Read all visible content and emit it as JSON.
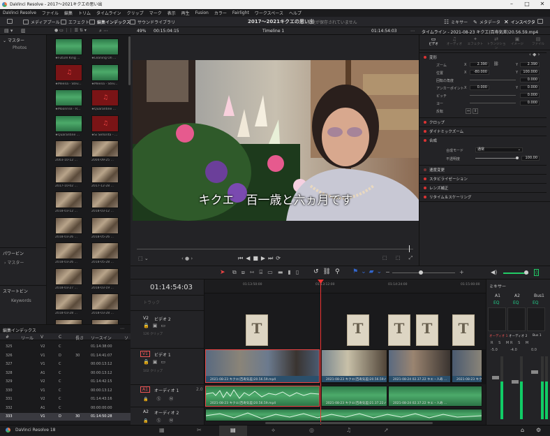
{
  "window": {
    "title": "DaVinci Resolve - 2017～2021キクエの思い出"
  },
  "menu": [
    "DaVinci Resolve",
    "ファイル",
    "編集",
    "トリム",
    "タイムライン",
    "クリップ",
    "マーク",
    "表示",
    "再生",
    "Fusion",
    "カラー",
    "Fairlight",
    "ワークスペース",
    "ヘルプ"
  ],
  "toolbar": {
    "media_pool": "メディアプール",
    "effects": "エフェクト",
    "edit_index": "編集インデックス",
    "sound_library": "サウンドライブラリ",
    "project_title": "2017～2021キクエの思い出",
    "save_status": "変更が保存されていません",
    "mixer": "ミキサー",
    "metadata": "メタデータ",
    "inspector": "インスペクタ"
  },
  "viewer_bar": {
    "zoom": "49%",
    "source_tc": "00:15:04:15",
    "timeline_name": "Timeline 1",
    "record_tc": "01:14:54:03",
    "clip_name": "タイムライン - 2021-08-23 キクエ(百寿気差)20.56.59.mp4"
  },
  "bins": {
    "master": "マスター",
    "photos": "Photos",
    "smart_header": "パワービン",
    "smart_master": "マスター",
    "smartbins": "スマートビン",
    "keywords": "Keywords"
  },
  "media_items": [
    {
      "label": "★Future King ...",
      "kind": "audio"
    },
    {
      "label": "★Leaning On ...",
      "kind": "audio"
    },
    {
      "label": "★Meena - Stev...",
      "kind": "red"
    },
    {
      "label": "★Meena - Stev...",
      "kind": "audio"
    },
    {
      "label": "★Moonrise - R...",
      "kind": "audio"
    },
    {
      "label": "★Quarantine ...",
      "kind": "red"
    },
    {
      "label": "★Quarantine ...",
      "kind": "audio"
    },
    {
      "label": "★Si Señorita - ...",
      "kind": "red"
    },
    {
      "label": "2003-10-12 ...",
      "kind": "photo"
    },
    {
      "label": "2004-09-25 ...",
      "kind": "photo"
    },
    {
      "label": "2017-10-02 ...",
      "kind": "photo"
    },
    {
      "label": "2017-12-28 ...",
      "kind": "photo"
    },
    {
      "label": "2018-03-12 ...",
      "kind": "photo"
    },
    {
      "label": "2018-03-12 ...",
      "kind": "photo"
    },
    {
      "label": "2018-03-26 ...",
      "kind": "photo"
    },
    {
      "label": "2018-05-26 ...",
      "kind": "photo"
    },
    {
      "label": "2018-03-26 ...",
      "kind": "photo"
    },
    {
      "label": "2018-05-28 ...",
      "kind": "photo"
    },
    {
      "label": "2018-03-27 ...",
      "kind": "photo"
    },
    {
      "label": "2018-03-19 ...",
      "kind": "photo"
    },
    {
      "label": "2018-03-28 ...",
      "kind": "photo"
    },
    {
      "label": "2018-03-28 ...",
      "kind": "photo"
    },
    {
      "label": "2018-05-27 ...",
      "kind": "photo"
    },
    {
      "label": "2018-11-17 ...",
      "kind": "photo"
    }
  ],
  "edit_index": {
    "title": "編集インデックス",
    "headers": [
      "#",
      "リール",
      "V",
      "C",
      "長さ",
      "ソースイン",
      "ソ"
    ],
    "rows": [
      [
        "325",
        "",
        "V2",
        "C",
        "",
        "01:14:38:00",
        ""
      ],
      [
        "326",
        "",
        "V1",
        "D",
        "30",
        "01:14:41:07",
        ""
      ],
      [
        "327",
        "",
        "V1",
        "C",
        "",
        "00:00:13:12",
        ""
      ],
      [
        "328",
        "",
        "A1",
        "C",
        "",
        "00:00:13:12",
        ""
      ],
      [
        "329",
        "",
        "V2",
        "C",
        "",
        "01:14:42:15",
        ""
      ],
      [
        "330",
        "",
        "V1",
        "C",
        "",
        "00:00:13:12",
        ""
      ],
      [
        "331",
        "",
        "V2",
        "C",
        "",
        "01:14:43:16",
        ""
      ],
      [
        "332",
        "",
        "A1",
        "C",
        "",
        "00:00:00:00",
        ""
      ],
      [
        "333",
        "",
        "V1",
        "D",
        "30",
        "01:14:50:28",
        ""
      ]
    ]
  },
  "viewer": {
    "subtitle": "キクエ　百一歳と六ヵ月です"
  },
  "inspector": {
    "tabs": [
      "ビデオ",
      "オーディオ",
      "エフェクト",
      "トランジション",
      "イメージ",
      "ファイル"
    ],
    "transform": "変形",
    "zoom_label": "ズーム",
    "zoom_x": "2.390",
    "zoom_y": "2.390",
    "position_label": "位置",
    "pos_x": "-80.000",
    "pos_y": "100.000",
    "rotation_label": "回転の角度",
    "rotation": "0.000",
    "anchor_label": "アンカーポイント",
    "anchor_x": "0.000",
    "anchor_y": "0.000",
    "pitch_label": "ピッチ",
    "pitch": "0.000",
    "yaw_label": "ヨー",
    "yaw": "0.000",
    "flip_label": "反転",
    "crop": "クロップ",
    "dynamic_zoom": "ダイナミックズーム",
    "composite": "合成",
    "composite_mode_label": "合成モード",
    "composite_mode": "通常",
    "opacity_label": "不透明度",
    "opacity": "100.00",
    "speed_change": "速度変更",
    "stabilization": "スタビライゼーション",
    "lens_correction": "レンズ補正",
    "retime": "リタイム＆スケーリング"
  },
  "timeline": {
    "timecode": "01:14:54:03",
    "ruler": [
      "01:13:50:00",
      "01:13:12:00",
      "01:14:24:00",
      "01:15:00:00"
    ],
    "track_v3": "トラック",
    "track_v2_id": "V2",
    "track_v2_name": "ビデオ 2",
    "track_v2_count": "126 クリップ",
    "track_v1_id": "V1",
    "track_v1_name": "ビデオ 1",
    "track_v1_count": "102 クリップ",
    "track_a1_id": "A1",
    "track_a1_name": "オーディオ 1",
    "track_a1_ch": "2.0",
    "track_a2_id": "A2",
    "track_a2_name": "オーディオ 2",
    "clip_a": "2021-08-23 キクエ(百寿気差)20.56.59.mp4",
    "clip_b": "2021-08-23 キクエ(百寿気差)20.56.59.mp4",
    "clip_c": "2021-08-23 キクエ(百寿気差)21.37.22.mp4",
    "clip_d": "2021-08-24 02.37.22 キエ・人寿 ...",
    "clip_e": "2021-08-23 キクエ(百寿気差)",
    "title_glyph": "T"
  },
  "mixer": {
    "title": "ミキサー",
    "ch": [
      "A1",
      "A2",
      "Bus1"
    ],
    "eq": "EQ",
    "out": "オーディオ 1",
    "out2": "オーディオ 2",
    "bus": "Bus 1",
    "m1": "-5.0",
    "m2": "-4.0",
    "m3": "0.0"
  },
  "bottombar": {
    "app": "DaVinci Resolve 18"
  }
}
